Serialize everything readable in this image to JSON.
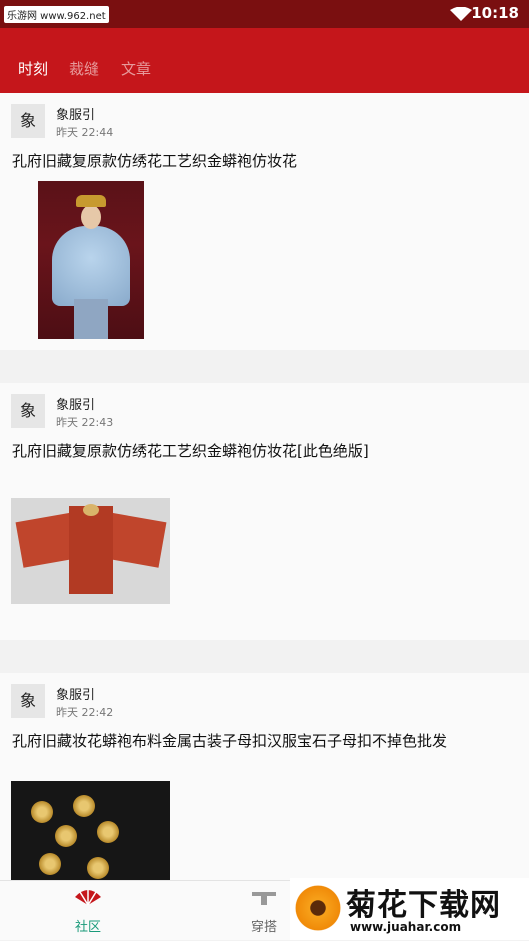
{
  "status_bar": {
    "source_label": "乐游网 www.962.net",
    "time": "10:18"
  },
  "tabs": [
    {
      "label": "时刻",
      "active": true
    },
    {
      "label": "裁缝",
      "active": false
    },
    {
      "label": "文章",
      "active": false
    }
  ],
  "posts": [
    {
      "avatar_text": "象",
      "author": "象服引",
      "time": "昨天 22:44",
      "title": "孔府旧藏复原款仿绣花工艺织金蟒袍仿妆花"
    },
    {
      "avatar_text": "象",
      "author": "象服引",
      "time": "昨天 22:43",
      "title": "孔府旧藏复原款仿绣花工艺织金蟒袍仿妆花[此色绝版]"
    },
    {
      "avatar_text": "象",
      "author": "象服引",
      "time": "昨天 22:42",
      "title": "孔府旧藏妆花蟒袍布料金属古装子母扣汉服宝石子母扣不掉色批发"
    }
  ],
  "bottom_nav": [
    {
      "label": "社区",
      "active": true,
      "icon": "fan-icon"
    },
    {
      "label": "穿搭",
      "active": false,
      "icon": "hanger-icon"
    }
  ],
  "watermark": {
    "title": "菊花下载网",
    "url": "www.juahar.com"
  },
  "colors": {
    "status_bar": "#7a0f10",
    "app_bar": "#c5161b",
    "active_nav": "#1a9a7a"
  }
}
